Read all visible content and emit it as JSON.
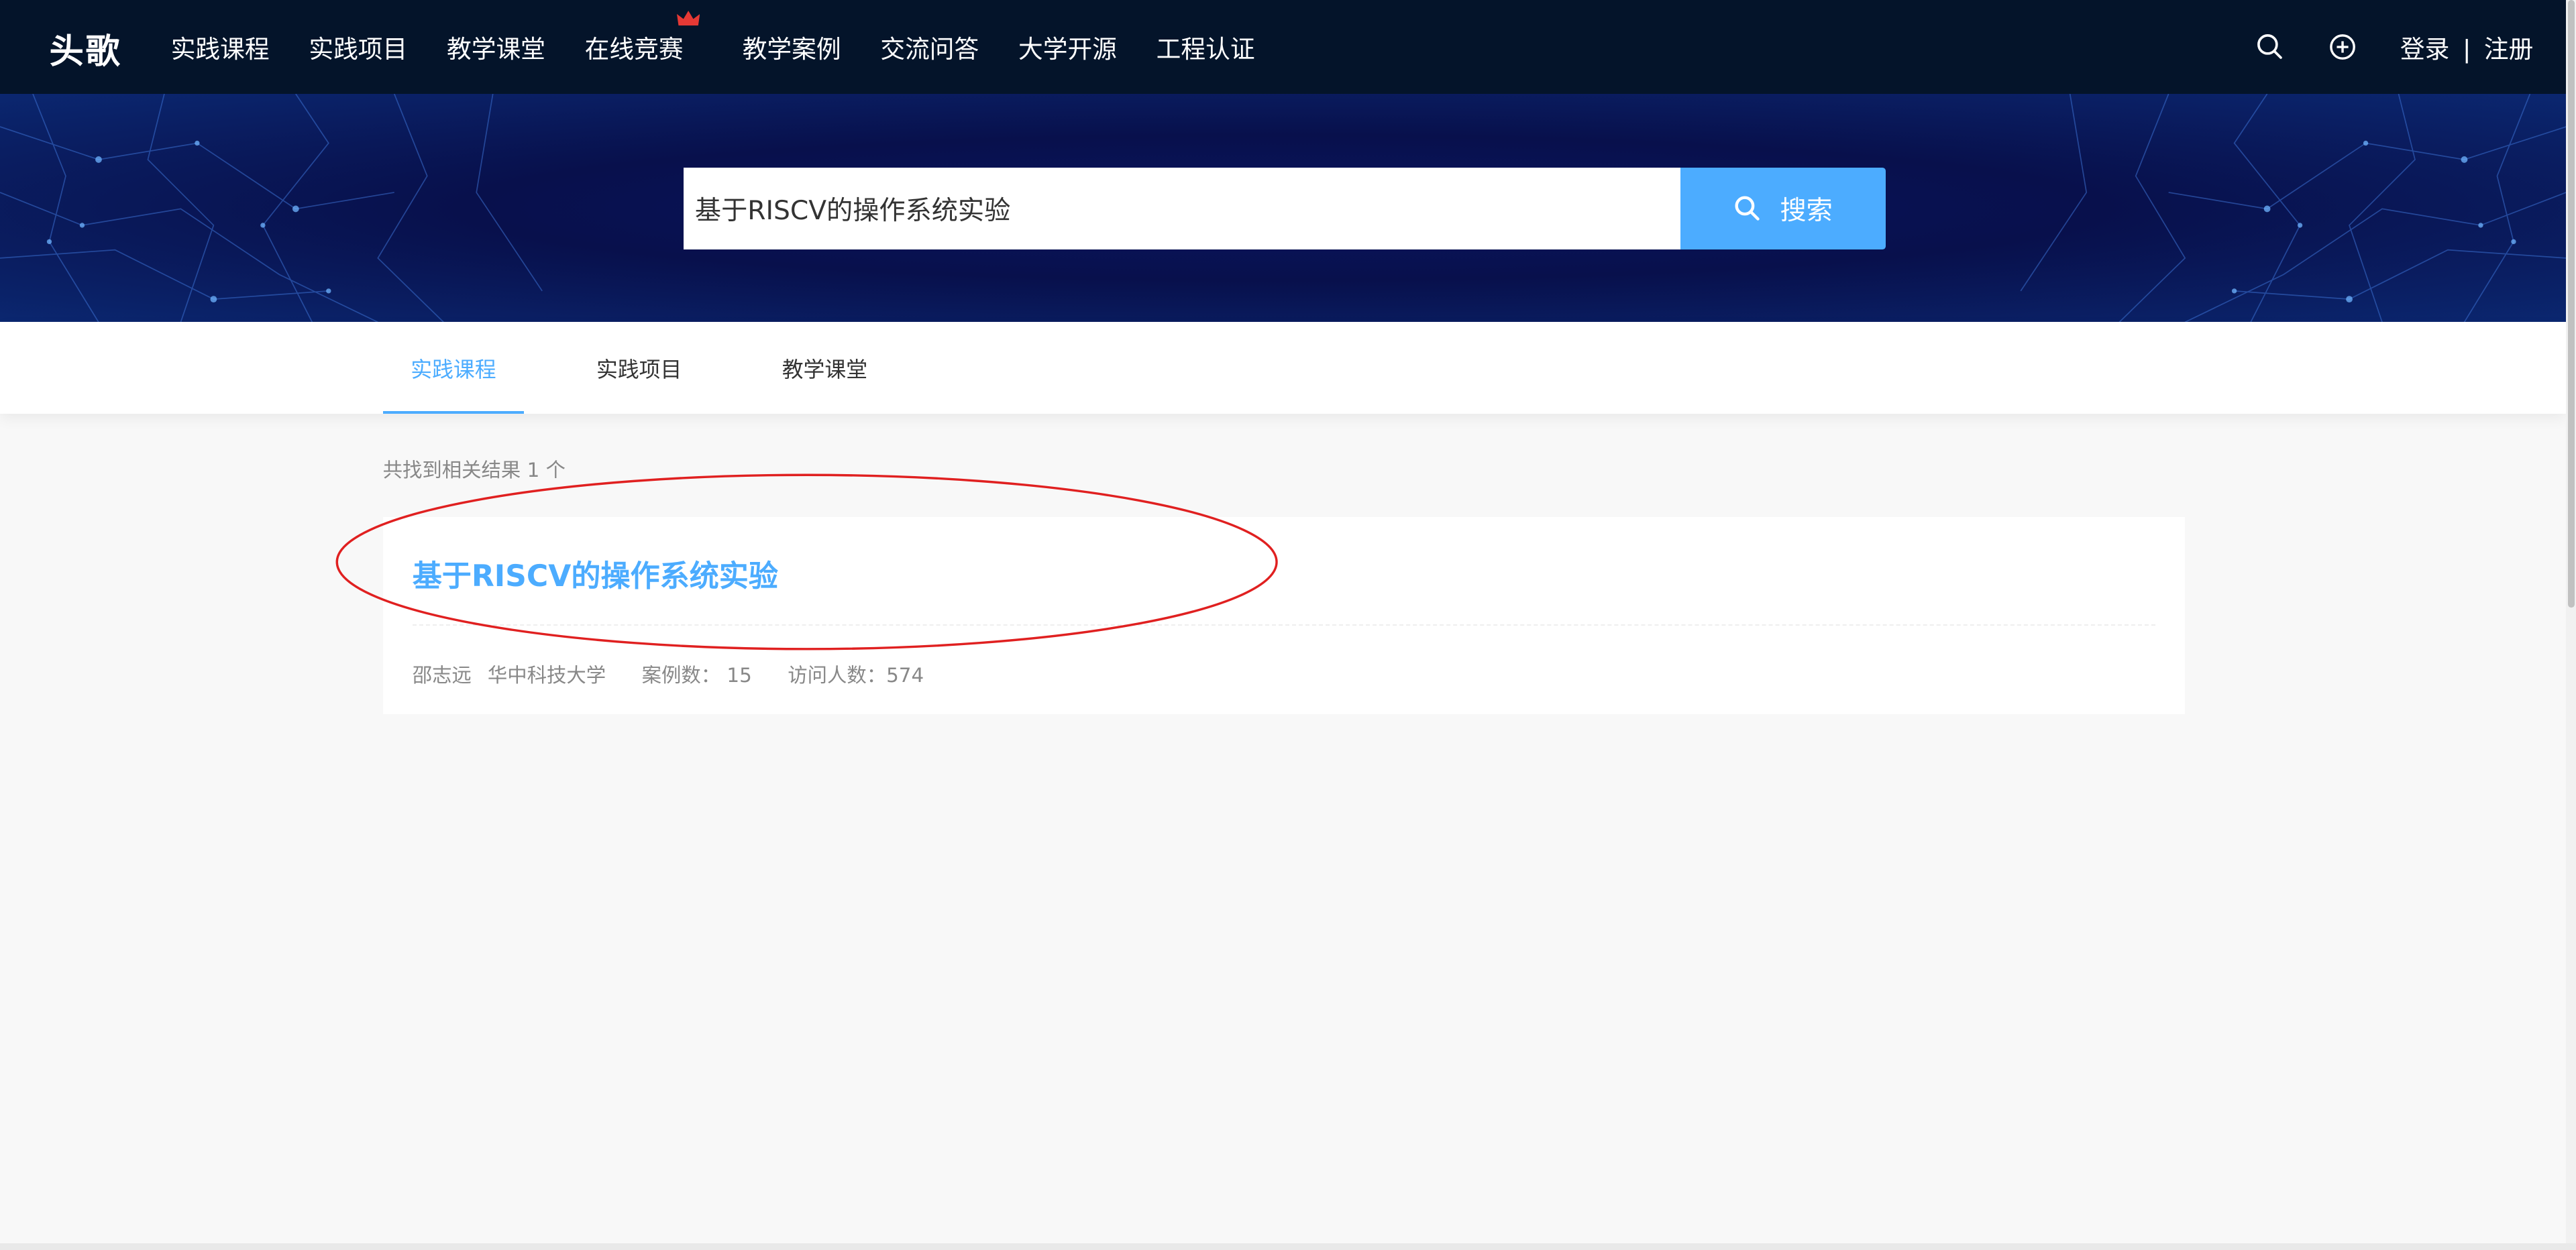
{
  "header": {
    "logo": "头歌",
    "nav": [
      {
        "label": "实践课程"
      },
      {
        "label": "实践项目"
      },
      {
        "label": "教学课堂"
      },
      {
        "label": "在线竞赛",
        "badge_icon": "crown-icon"
      },
      {
        "label": "教学案例"
      },
      {
        "label": "交流问答"
      },
      {
        "label": "大学开源"
      },
      {
        "label": "工程认证"
      }
    ],
    "icons": [
      "search-icon",
      "plus-circle-icon"
    ],
    "login": "登录",
    "separator": "|",
    "register": "注册"
  },
  "search": {
    "value": "基于RISCV的操作系统实验",
    "button_label": "搜索",
    "button_icon": "search-icon"
  },
  "tabs": [
    {
      "label": "实践课程",
      "active": true
    },
    {
      "label": "实践项目",
      "active": false
    },
    {
      "label": "教学课堂",
      "active": false
    }
  ],
  "results": {
    "count_text": "共找到相关结果 1 个",
    "items": [
      {
        "title": "基于RISCV的操作系统实验",
        "author": "邵志远",
        "university": "华中科技大学",
        "cases": "案例数： 15",
        "visits": "访问人数：574"
      }
    ]
  },
  "colors": {
    "nav_bg": "#04142a",
    "accent": "#4cacff",
    "hero_bg": "#08104c",
    "annotation": "#e02020",
    "crown": "#e53935"
  }
}
